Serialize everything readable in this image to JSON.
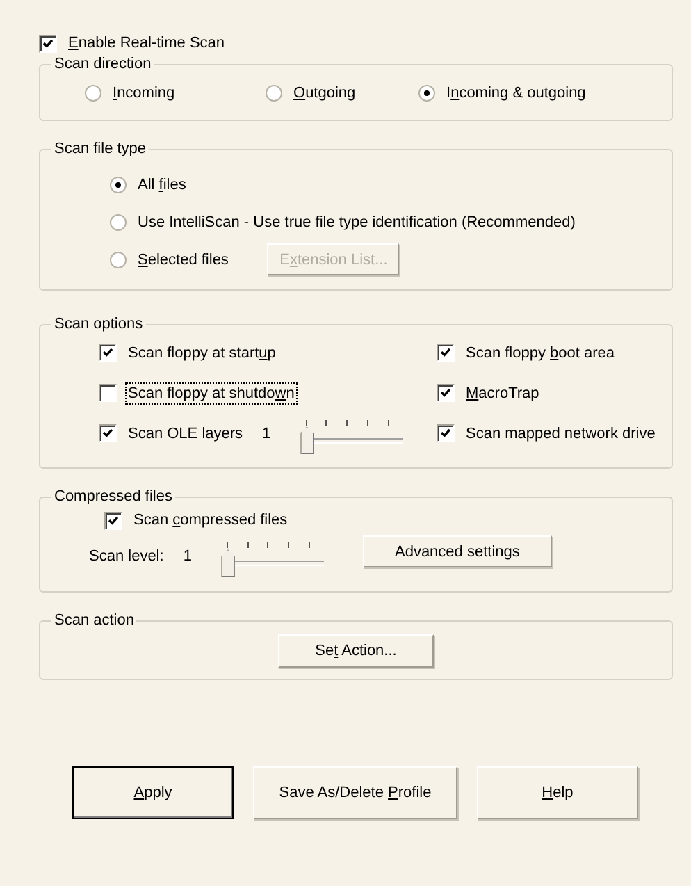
{
  "enable_realtime_scan": {
    "key": "E",
    "after": "nable Real-time Scan",
    "checked": true
  },
  "scan_direction": {
    "title": "Scan direction",
    "options": [
      {
        "key": "I",
        "after": "ncoming",
        "selected": false
      },
      {
        "key": "O",
        "after": "utgoing",
        "selected": false
      },
      {
        "before": "I",
        "key": "n",
        "after": "coming & outgoing",
        "selected": true
      }
    ]
  },
  "scan_file_type": {
    "title": "Scan file type",
    "options": [
      {
        "before": "All ",
        "key": "f",
        "after": "iles",
        "selected": true
      },
      {
        "before": "Use IntelliScan - Use true file type identification (Recommended)",
        "selected": false
      },
      {
        "key": "S",
        "after": "elected files",
        "selected": false
      }
    ],
    "extension_button": {
      "before": "E",
      "key": "x",
      "after": "tension List...",
      "disabled": true
    }
  },
  "scan_options": {
    "title": "Scan options",
    "left": [
      {
        "kind": "checkbox",
        "before": "Scan floppy at start",
        "key": "u",
        "after": "p",
        "checked": true,
        "focused": false
      },
      {
        "kind": "checkbox",
        "before": "Scan floppy at shutdo",
        "key": "w",
        "after": "n",
        "checked": false,
        "focused": true
      },
      {
        "kind": "slider",
        "before": "Scan OLE layers",
        "checked": true,
        "focused": false,
        "value": "1",
        "level": 0
      }
    ],
    "right": [
      {
        "kind": "checkbox",
        "before": "Scan floppy ",
        "key": "b",
        "after": "oot area",
        "checked": true,
        "focused": false
      },
      {
        "kind": "checkbox",
        "key": "M",
        "after": "acroTrap",
        "checked": true,
        "focused": false
      },
      {
        "kind": "checkbox",
        "before": "Scan mapped network drive",
        "checked": true,
        "focused": false
      }
    ]
  },
  "compressed_files": {
    "title": "Compressed files",
    "checkbox": {
      "before": "Scan ",
      "key": "c",
      "after": "ompressed files",
      "checked": true
    },
    "scan_level": {
      "label": "Scan level:",
      "value": "1",
      "level": 0
    },
    "advanced_button": {
      "before": "Advanced settings"
    }
  },
  "scan_action": {
    "title": "Scan action",
    "button": {
      "before": "Se",
      "key": "t",
      "after": " Action..."
    }
  },
  "buttons": [
    {
      "key": "A",
      "after": "pply",
      "default": true
    },
    {
      "before": "Save As/Delete ",
      "key": "P",
      "after": "rofile",
      "default": false
    },
    {
      "key": "H",
      "after": "elp",
      "default": false
    }
  ]
}
